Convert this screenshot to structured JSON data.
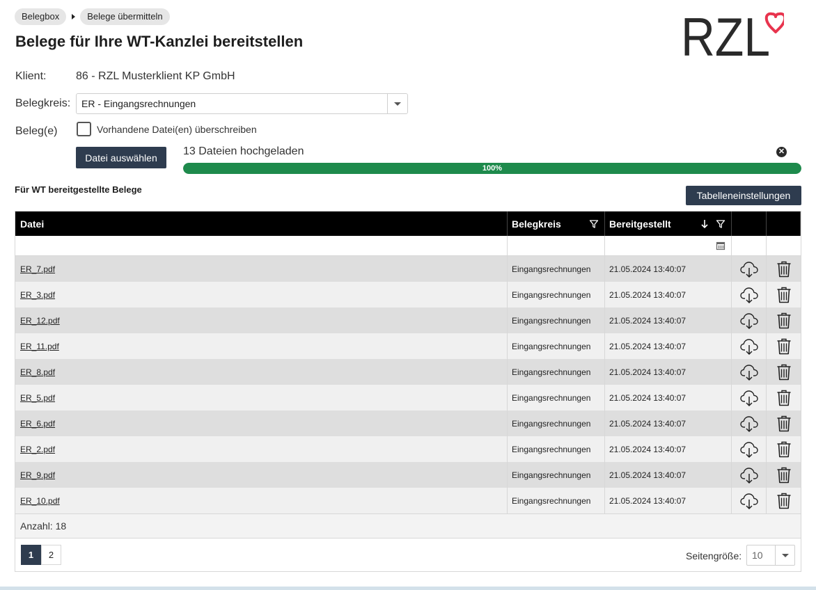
{
  "breadcrumb": {
    "items": [
      "Belegbox",
      "Belege übermitteln"
    ]
  },
  "page": {
    "title": "Belege für Ihre WT-Kanzlei bereitstellen"
  },
  "logo": {
    "text": "RZL",
    "accent_color": "#e8344e"
  },
  "form": {
    "client_label": "Klient:",
    "client_value": "86 - RZL Musterklient KP GmbH",
    "belegkreis_label": "Belegkreis:",
    "belegkreis_value": "ER - Eingangsrechnungen",
    "belege_label": "Beleg(e)",
    "overwrite_label": "Vorhandene Datei(en) überschreiben",
    "overwrite_checked": false,
    "select_file_button": "Datei auswählen"
  },
  "upload": {
    "status": "13 Dateien hochgeladen",
    "progress": 100,
    "progress_label": "100%"
  },
  "section": {
    "title": "Für WT bereitgestellte Belege",
    "table_settings_button": "Tabelleneinstellungen"
  },
  "table": {
    "columns": [
      "Datei",
      "Belegkreis",
      "Bereitgestellt"
    ],
    "rows": [
      {
        "file": "ER_7.pdf",
        "belegkreis": "Eingangsrechnungen",
        "bereitgestellt": "21.05.2024 13:40:07"
      },
      {
        "file": "ER_3.pdf",
        "belegkreis": "Eingangsrechnungen",
        "bereitgestellt": "21.05.2024 13:40:07"
      },
      {
        "file": "ER_12.pdf",
        "belegkreis": "Eingangsrechnungen",
        "bereitgestellt": "21.05.2024 13:40:07"
      },
      {
        "file": "ER_11.pdf",
        "belegkreis": "Eingangsrechnungen",
        "bereitgestellt": "21.05.2024 13:40:07"
      },
      {
        "file": "ER_8.pdf",
        "belegkreis": "Eingangsrechnungen",
        "bereitgestellt": "21.05.2024 13:40:07"
      },
      {
        "file": "ER_5.pdf",
        "belegkreis": "Eingangsrechnungen",
        "bereitgestellt": "21.05.2024 13:40:07"
      },
      {
        "file": "ER_6.pdf",
        "belegkreis": "Eingangsrechnungen",
        "bereitgestellt": "21.05.2024 13:40:07"
      },
      {
        "file": "ER_2.pdf",
        "belegkreis": "Eingangsrechnungen",
        "bereitgestellt": "21.05.2024 13:40:07"
      },
      {
        "file": "ER_9.pdf",
        "belegkreis": "Eingangsrechnungen",
        "bereitgestellt": "21.05.2024 13:40:07"
      },
      {
        "file": "ER_10.pdf",
        "belegkreis": "Eingangsrechnungen",
        "bereitgestellt": "21.05.2024 13:40:07"
      }
    ],
    "count_text": "Anzahl: 18",
    "pages": [
      "1",
      "2"
    ],
    "active_page": "1",
    "page_size_label": "Seitengröße:",
    "page_size_value": "10"
  },
  "icons": {
    "breadcrumb_separator": "triangle-right-icon",
    "close": "close-circle-icon",
    "filter": "filter-icon",
    "sort": "sort-down-arrow-icon",
    "calendar": "calendar-icon",
    "download": "cloud-download-icon",
    "delete": "trash-icon",
    "dropdown": "chevron-down-icon"
  },
  "colors": {
    "primary_dark": "#2e3c4f",
    "progress_green": "#1e8a4c",
    "header_black": "#000000"
  }
}
